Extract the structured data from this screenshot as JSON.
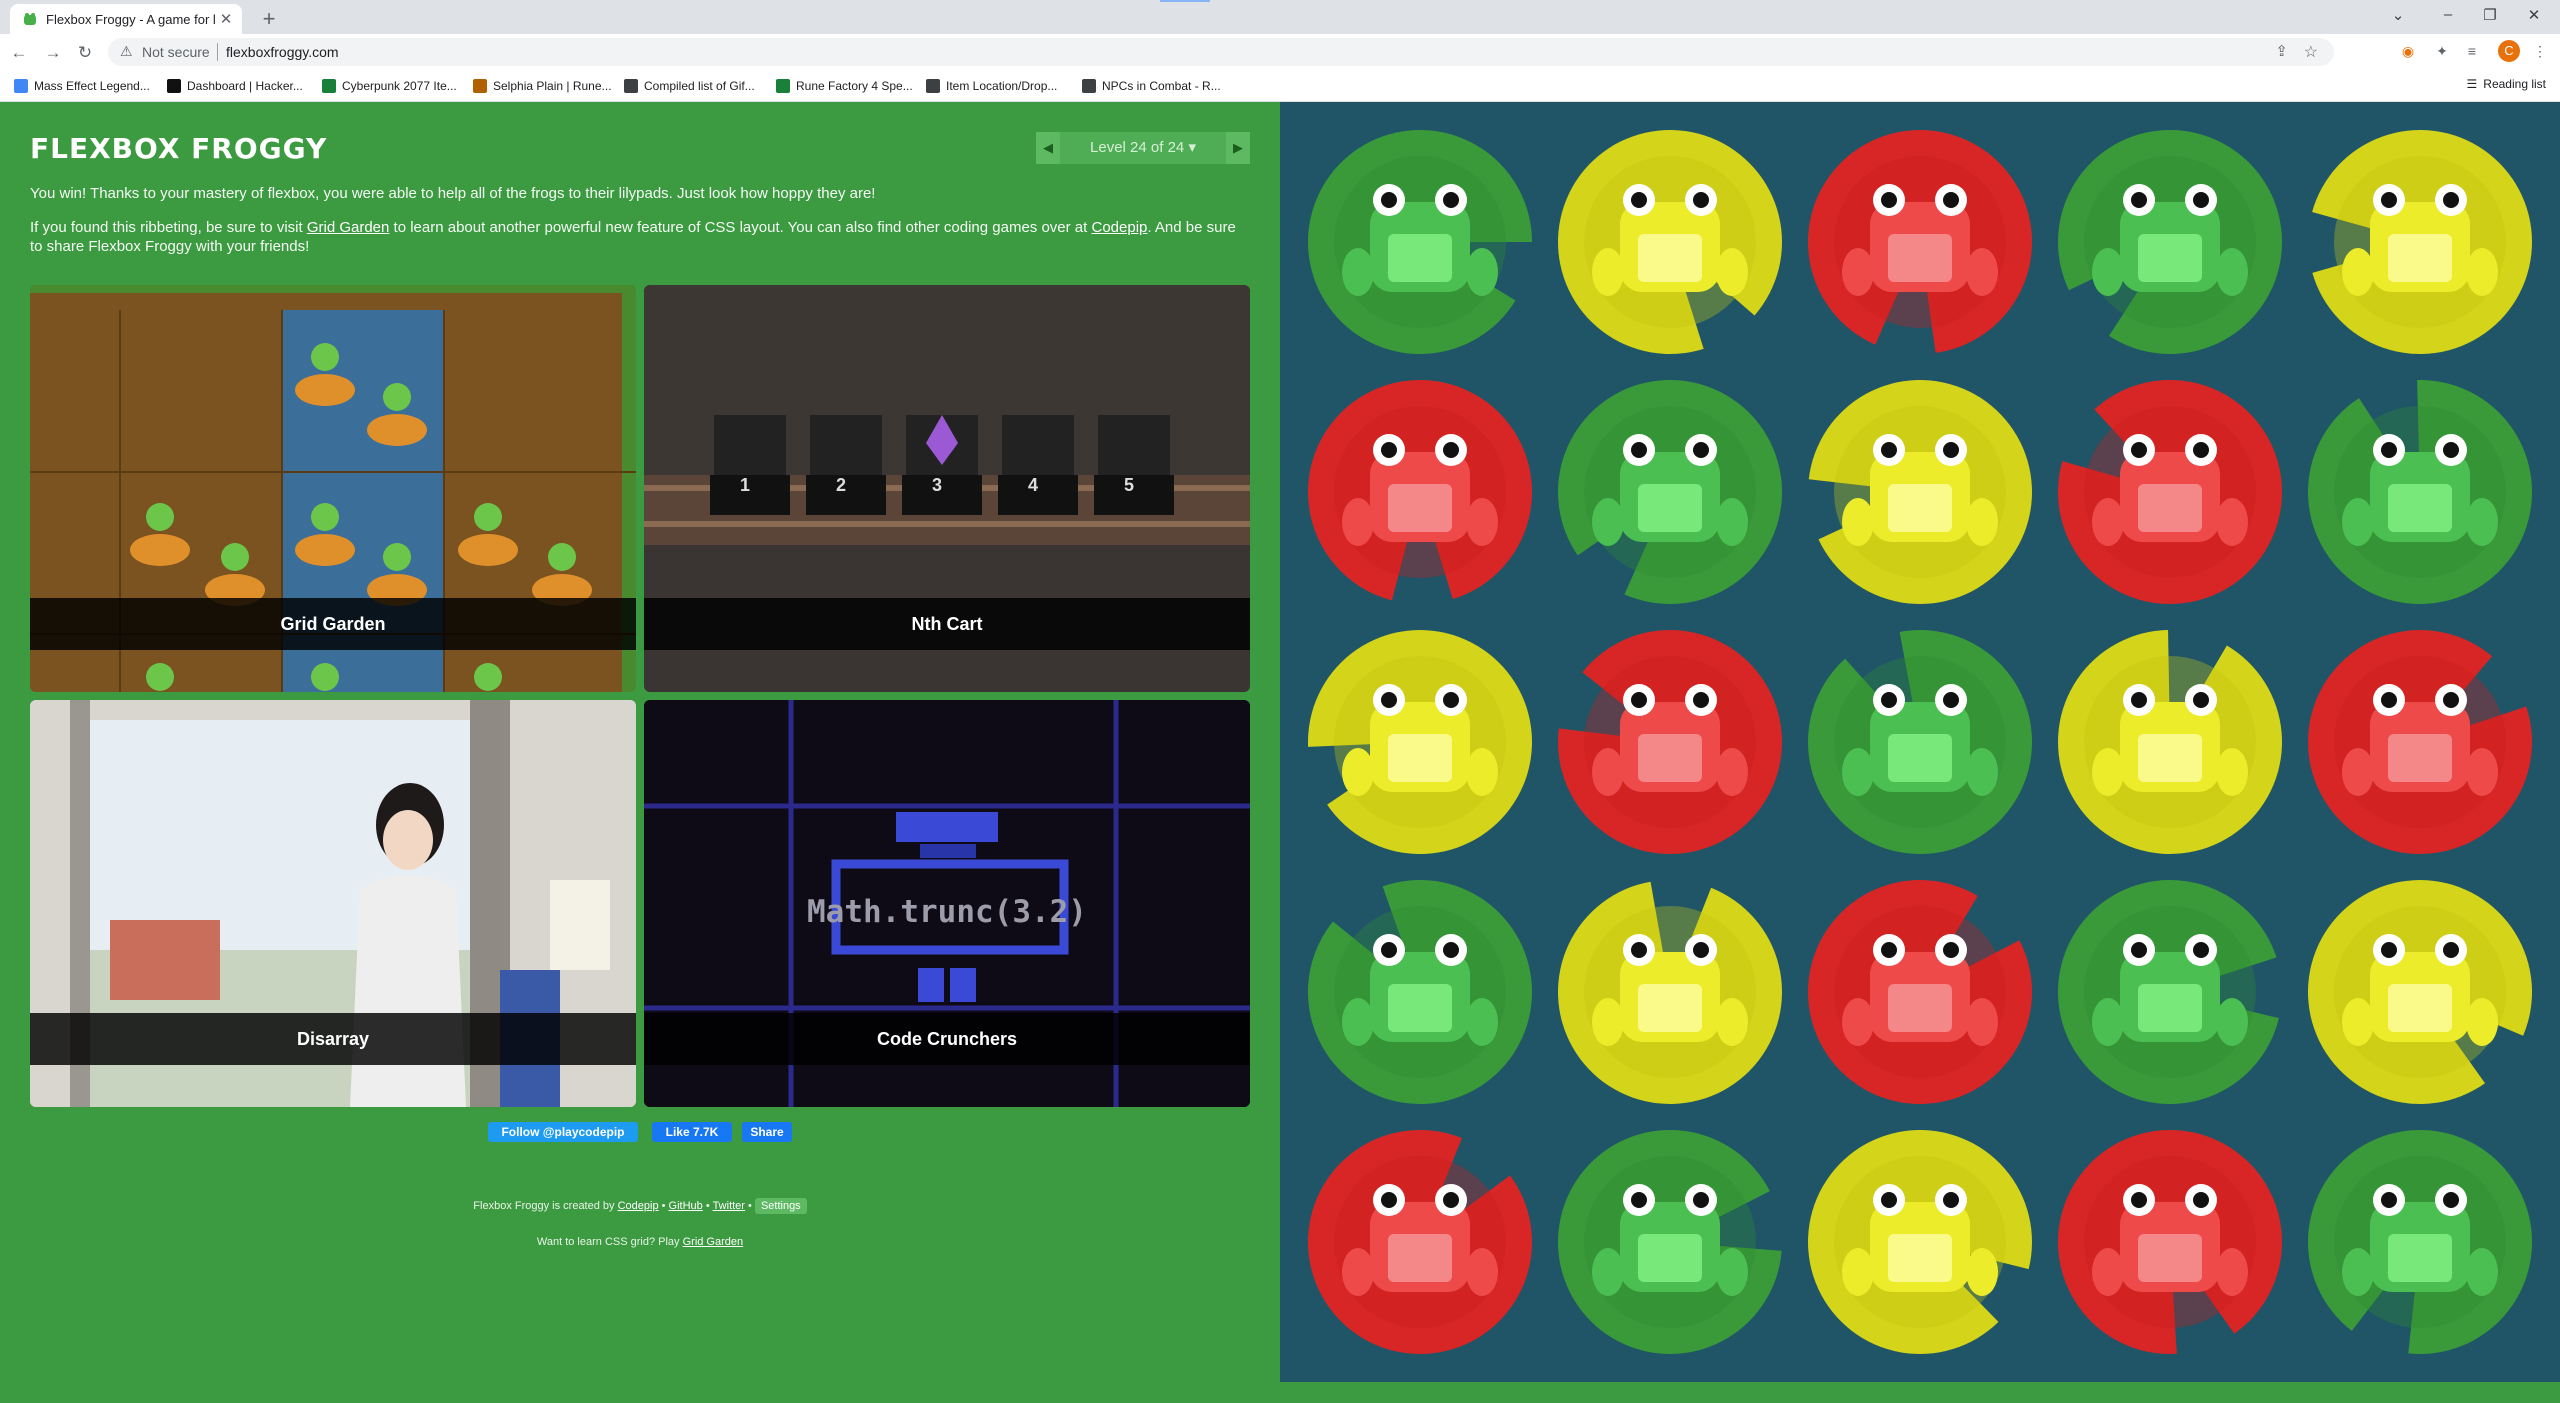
{
  "browser": {
    "tab_title": "Flexbox Froggy - A game for lea",
    "tab_close": "✕",
    "new_tab": "+",
    "security": "Not secure",
    "url": "flexboxfroggy.com",
    "avatar_letter": "C",
    "bookmarks": [
      {
        "label": "Mass Effect Legend...",
        "color": "#4285f4"
      },
      {
        "label": "Dashboard | Hacker...",
        "color": "#111111"
      },
      {
        "label": "Cyberpunk 2077 Ite...",
        "color": "#188038"
      },
      {
        "label": "Selphia Plain | Rune...",
        "color": "#b06000"
      },
      {
        "label": "Compiled list of Gif...",
        "color": "#3c4043"
      },
      {
        "label": "Rune Factory 4 Spe...",
        "color": "#188038"
      },
      {
        "label": "Item Location/Drop...",
        "color": "#3c4043"
      },
      {
        "label": "NPCs in Combat - R...",
        "color": "#3c4043"
      }
    ],
    "reading_list": "Reading list"
  },
  "game": {
    "logo": "FLEXBOX FROGGY",
    "level_label": "Level 24 of 24 ▾",
    "prev": "◀",
    "next": "▶",
    "win_message": "You win! Thanks to your mastery of flexbox, you were able to help all of the frogs to their lilypads. Just look how hoppy they are!",
    "promo_1": "If you found this ribbeting, be sure to visit ",
    "promo_link_grid": "Grid Garden",
    "promo_2": " to learn about another powerful new feature of CSS layout. You can also find other coding games over at ",
    "promo_link_codepip": "Codepip",
    "promo_3": ". And be sure to share Flexbox Froggy with your friends!",
    "cards": [
      {
        "title": "Grid Garden"
      },
      {
        "title": "Nth Cart"
      },
      {
        "title": "Disarray"
      },
      {
        "title": "Code Crunchers"
      }
    ],
    "nth_cart_numbers": [
      "1",
      "2",
      "3",
      "4",
      "5"
    ],
    "code_crunchers_text": "Math.trunc(3.2)",
    "social": {
      "twitter": "Follow @playcodepip",
      "like": "Like 7.7K",
      "share": "Share"
    },
    "footer": {
      "created_by": "Flexbox Froggy is created by ",
      "codepip": "Codepip",
      "dot": " • ",
      "github": "GitHub",
      "twitter": "Twitter",
      "settings": "Settings",
      "learn_grid": "Want to learn CSS grid? Play ",
      "grid_garden": "Grid Garden"
    }
  },
  "pond": {
    "colors": {
      "green": "#3a9a3a",
      "yellow": "#d4d41a",
      "red": "#d82626",
      "background": "#1f5567"
    },
    "rows": [
      [
        "green",
        "yellow",
        "red",
        "green",
        "yellow"
      ],
      [
        "red",
        "green",
        "yellow",
        "red",
        "green"
      ],
      [
        "yellow",
        "red",
        "green",
        "yellow",
        "red"
      ],
      [
        "green",
        "yellow",
        "red",
        "green",
        "yellow"
      ],
      [
        "red",
        "green",
        "yellow",
        "red",
        "green"
      ]
    ]
  }
}
